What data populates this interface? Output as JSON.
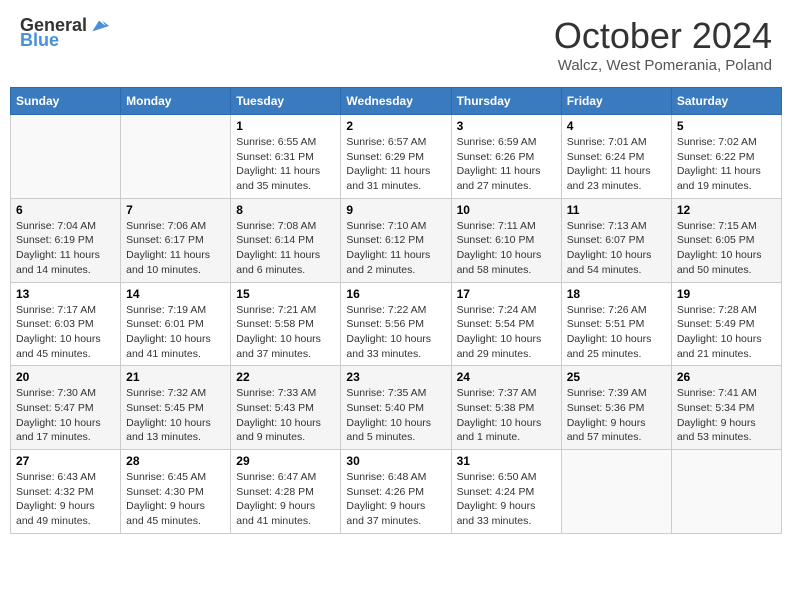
{
  "header": {
    "logo_general": "General",
    "logo_blue": "Blue",
    "title": "October 2024",
    "location": "Walcz, West Pomerania, Poland"
  },
  "days_of_week": [
    "Sunday",
    "Monday",
    "Tuesday",
    "Wednesday",
    "Thursday",
    "Friday",
    "Saturday"
  ],
  "weeks": [
    [
      {
        "day": "",
        "detail": ""
      },
      {
        "day": "",
        "detail": ""
      },
      {
        "day": "1",
        "detail": "Sunrise: 6:55 AM\nSunset: 6:31 PM\nDaylight: 11 hours and 35 minutes."
      },
      {
        "day": "2",
        "detail": "Sunrise: 6:57 AM\nSunset: 6:29 PM\nDaylight: 11 hours and 31 minutes."
      },
      {
        "day": "3",
        "detail": "Sunrise: 6:59 AM\nSunset: 6:26 PM\nDaylight: 11 hours and 27 minutes."
      },
      {
        "day": "4",
        "detail": "Sunrise: 7:01 AM\nSunset: 6:24 PM\nDaylight: 11 hours and 23 minutes."
      },
      {
        "day": "5",
        "detail": "Sunrise: 7:02 AM\nSunset: 6:22 PM\nDaylight: 11 hours and 19 minutes."
      }
    ],
    [
      {
        "day": "6",
        "detail": "Sunrise: 7:04 AM\nSunset: 6:19 PM\nDaylight: 11 hours and 14 minutes."
      },
      {
        "day": "7",
        "detail": "Sunrise: 7:06 AM\nSunset: 6:17 PM\nDaylight: 11 hours and 10 minutes."
      },
      {
        "day": "8",
        "detail": "Sunrise: 7:08 AM\nSunset: 6:14 PM\nDaylight: 11 hours and 6 minutes."
      },
      {
        "day": "9",
        "detail": "Sunrise: 7:10 AM\nSunset: 6:12 PM\nDaylight: 11 hours and 2 minutes."
      },
      {
        "day": "10",
        "detail": "Sunrise: 7:11 AM\nSunset: 6:10 PM\nDaylight: 10 hours and 58 minutes."
      },
      {
        "day": "11",
        "detail": "Sunrise: 7:13 AM\nSunset: 6:07 PM\nDaylight: 10 hours and 54 minutes."
      },
      {
        "day": "12",
        "detail": "Sunrise: 7:15 AM\nSunset: 6:05 PM\nDaylight: 10 hours and 50 minutes."
      }
    ],
    [
      {
        "day": "13",
        "detail": "Sunrise: 7:17 AM\nSunset: 6:03 PM\nDaylight: 10 hours and 45 minutes."
      },
      {
        "day": "14",
        "detail": "Sunrise: 7:19 AM\nSunset: 6:01 PM\nDaylight: 10 hours and 41 minutes."
      },
      {
        "day": "15",
        "detail": "Sunrise: 7:21 AM\nSunset: 5:58 PM\nDaylight: 10 hours and 37 minutes."
      },
      {
        "day": "16",
        "detail": "Sunrise: 7:22 AM\nSunset: 5:56 PM\nDaylight: 10 hours and 33 minutes."
      },
      {
        "day": "17",
        "detail": "Sunrise: 7:24 AM\nSunset: 5:54 PM\nDaylight: 10 hours and 29 minutes."
      },
      {
        "day": "18",
        "detail": "Sunrise: 7:26 AM\nSunset: 5:51 PM\nDaylight: 10 hours and 25 minutes."
      },
      {
        "day": "19",
        "detail": "Sunrise: 7:28 AM\nSunset: 5:49 PM\nDaylight: 10 hours and 21 minutes."
      }
    ],
    [
      {
        "day": "20",
        "detail": "Sunrise: 7:30 AM\nSunset: 5:47 PM\nDaylight: 10 hours and 17 minutes."
      },
      {
        "day": "21",
        "detail": "Sunrise: 7:32 AM\nSunset: 5:45 PM\nDaylight: 10 hours and 13 minutes."
      },
      {
        "day": "22",
        "detail": "Sunrise: 7:33 AM\nSunset: 5:43 PM\nDaylight: 10 hours and 9 minutes."
      },
      {
        "day": "23",
        "detail": "Sunrise: 7:35 AM\nSunset: 5:40 PM\nDaylight: 10 hours and 5 minutes."
      },
      {
        "day": "24",
        "detail": "Sunrise: 7:37 AM\nSunset: 5:38 PM\nDaylight: 10 hours and 1 minute."
      },
      {
        "day": "25",
        "detail": "Sunrise: 7:39 AM\nSunset: 5:36 PM\nDaylight: 9 hours and 57 minutes."
      },
      {
        "day": "26",
        "detail": "Sunrise: 7:41 AM\nSunset: 5:34 PM\nDaylight: 9 hours and 53 minutes."
      }
    ],
    [
      {
        "day": "27",
        "detail": "Sunrise: 6:43 AM\nSunset: 4:32 PM\nDaylight: 9 hours and 49 minutes."
      },
      {
        "day": "28",
        "detail": "Sunrise: 6:45 AM\nSunset: 4:30 PM\nDaylight: 9 hours and 45 minutes."
      },
      {
        "day": "29",
        "detail": "Sunrise: 6:47 AM\nSunset: 4:28 PM\nDaylight: 9 hours and 41 minutes."
      },
      {
        "day": "30",
        "detail": "Sunrise: 6:48 AM\nSunset: 4:26 PM\nDaylight: 9 hours and 37 minutes."
      },
      {
        "day": "31",
        "detail": "Sunrise: 6:50 AM\nSunset: 4:24 PM\nDaylight: 9 hours and 33 minutes."
      },
      {
        "day": "",
        "detail": ""
      },
      {
        "day": "",
        "detail": ""
      }
    ]
  ]
}
